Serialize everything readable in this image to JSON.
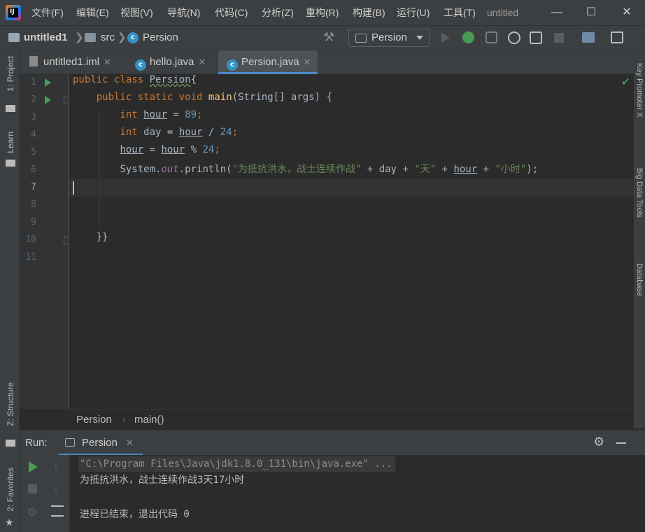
{
  "app": {
    "logo_text": "IJ",
    "menu": [
      "文件(F)",
      "编辑(E)",
      "视图(V)",
      "导航(N)",
      "代码(C)",
      "分析(Z)",
      "重构(R)",
      "构建(B)",
      "运行(U)",
      "工具(T)"
    ],
    "window_title": "untitled"
  },
  "navbar": {
    "project": "untitled1",
    "folder": "src",
    "file": "Persion",
    "run_config": "Persion"
  },
  "tabs": [
    {
      "label": "untitled1.iml"
    },
    {
      "label": "hello.java"
    },
    {
      "label": "Persion.java"
    }
  ],
  "left_stripe": {
    "project": "1: Project",
    "learn": "Learn",
    "structure": "Z: Structure",
    "favorites": "2: Favorites"
  },
  "right_stripe": {
    "key_promoter": "Key Promoter X",
    "big_data": "Big Data Tools",
    "database": "Database"
  },
  "editor": {
    "line_numbers": [
      "1",
      "2",
      "3",
      "4",
      "5",
      "6",
      "7",
      "8",
      "9",
      "10",
      "11"
    ],
    "current_line": "7",
    "code": {
      "l1_kw1": "public",
      "l1_kw2": "class",
      "l1_name": "Persion",
      "l1_rest": "{",
      "l2_kw1": "public",
      "l2_kw2": "static",
      "l2_kw3": "void",
      "l2_fn": "main",
      "l2_rest": "(String[] args) {",
      "l3_kw": "int",
      "l3_var": "hour",
      "l3_eq": " = ",
      "l3_num": "89",
      "l3_end": ";",
      "l4_kw": "int",
      "l4_var": "day",
      "l4_eq": " = ",
      "l4_ref": "hour",
      "l4_op": " / ",
      "l4_num": "24",
      "l4_end": ";",
      "l5_var": "hour",
      "l5_eq": " = ",
      "l5_ref": "hour",
      "l5_op": " % ",
      "l5_num": "24",
      "l5_end": ";",
      "l6_a": "System.",
      "l6_out": "out",
      "l6_b": ".println(",
      "l6_s1": "\"为抵抗洪水，战士连续作战\"",
      "l6_c": " + day + ",
      "l6_s2": "\"天\"",
      "l6_d": " + ",
      "l6_ref": "hour",
      "l6_e": " + ",
      "l6_s3": "\"小时\"",
      "l6_f": ");",
      "l10": "}}"
    }
  },
  "breadcrumbs": {
    "class": "Persion",
    "method": "main()"
  },
  "run_panel": {
    "label": "Run:",
    "tab": "Persion",
    "console": [
      "\"C:\\Program Files\\Java\\jdk1.8.0_131\\bin\\java.exe\" ...",
      "为抵抗洪水，战士连续作战3天17小时",
      "",
      "进程已结束，退出代码 0"
    ]
  },
  "colors": {
    "keyword": "#cc7832",
    "number": "#6897bb",
    "string": "#6a8759",
    "function": "#ffc66d",
    "accent": "#4a88c7"
  }
}
